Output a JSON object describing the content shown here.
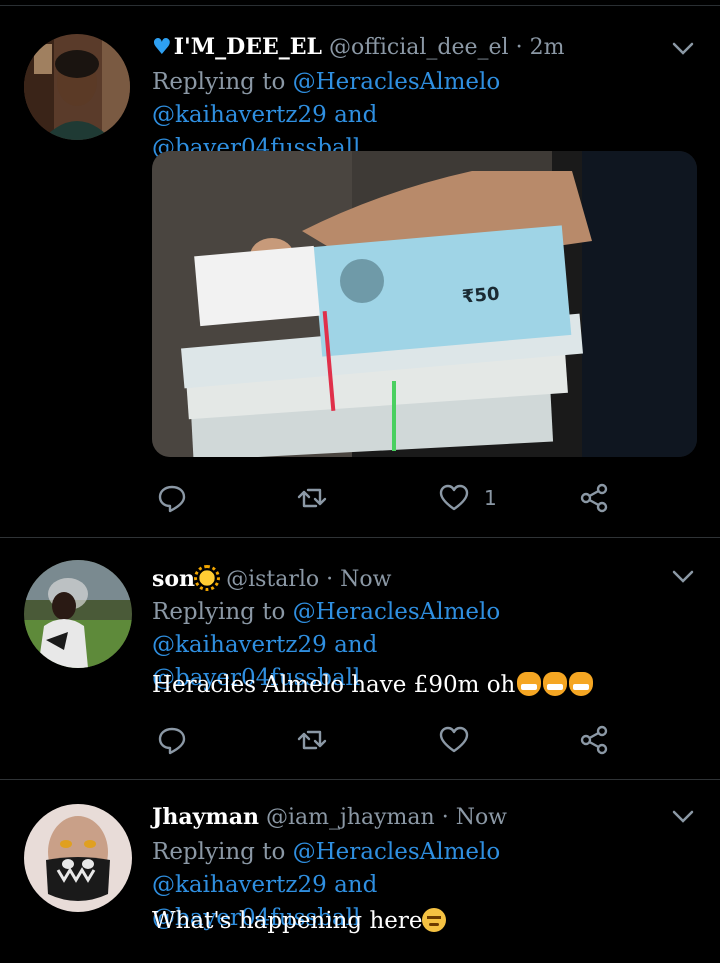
{
  "tweets": [
    {
      "name": "I'M_DEE_EL",
      "handle": "@official_dee_el",
      "separator": "·",
      "time": "2m",
      "replying_prefix": "Replying to",
      "mentions": [
        "@HeraclesAlmelo",
        "@kaihavertz29",
        "@bayer04fussball"
      ],
      "and_word": "and",
      "has_image": true,
      "like_count": "1"
    },
    {
      "name": "son",
      "handle": "@istarlo",
      "separator": "·",
      "time": "Now",
      "replying_prefix": "Replying to",
      "mentions": [
        "@HeraclesAlmelo",
        "@kaihavertz29",
        "@bayer04fussball"
      ],
      "and_word": "and",
      "text": "Heracles Almelo have £90m oh"
    },
    {
      "name": "Jhayman",
      "handle": "@iam_jhayman",
      "separator": "·",
      "time": "Now",
      "replying_prefix": "Replying to",
      "mentions": [
        "@HeraclesAlmelo",
        "@kaihavertz29",
        "@bayer04fussball"
      ],
      "and_word": "and",
      "text": "What's happening here"
    }
  ],
  "icons": {
    "reply": "reply-icon",
    "retweet": "retweet-icon",
    "like": "heart-icon",
    "share": "share-icon",
    "menu": "chevron-down-icon"
  },
  "colors": {
    "background": "#000000",
    "mention": "#2f8fe0",
    "muted": "#8b98a5",
    "name": "#ffffff",
    "verified_heart": "#2ea0f2"
  }
}
